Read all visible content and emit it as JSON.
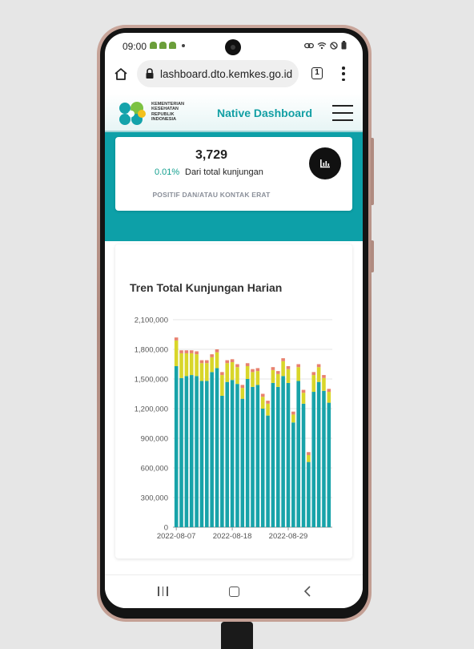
{
  "status_bar": {
    "time": "09:00",
    "right_icons": [
      "link-icon",
      "wifi-icon",
      "do-not-disturb-icon",
      "battery-icon"
    ]
  },
  "browser": {
    "url": "lashboard.dto.kemkes.go.id",
    "tab_count": "1"
  },
  "site": {
    "logo_text": [
      "KEMENTERIAN",
      "KESEHATAN",
      "REPUBLIK",
      "INDONESIA"
    ],
    "title": "Native Dashboard"
  },
  "stat_card": {
    "value": "3,729",
    "percent": "0.01%",
    "description": "Dari total kunjungan",
    "label": "POSITIF DAN/ATAU KONTAK ERAT"
  },
  "colors": {
    "teal": "#0da0a8",
    "series_main": "#18a3a9",
    "series_mid": "#d9d62a",
    "series_top": "#e8826e"
  },
  "chart_data": {
    "type": "bar",
    "stacked": true,
    "title": "Tren Total Kunjungan Harian",
    "x_tick_labels": [
      "2022-08-07",
      "2022-08-18",
      "2022-08-29"
    ],
    "y_ticks": [
      0,
      300000,
      600000,
      900000,
      1200000,
      1500000,
      1800000,
      2100000
    ],
    "y_tick_labels": [
      "0",
      "300,000",
      "600,000",
      "900,000",
      "1,200,000",
      "1,500,000",
      "1,800,000",
      "2,100,000"
    ],
    "ylim": [
      0,
      2100000
    ],
    "grid": true,
    "legend": "none",
    "categories": [
      "2022-08-07",
      "2022-08-08",
      "2022-08-09",
      "2022-08-10",
      "2022-08-11",
      "2022-08-12",
      "2022-08-13",
      "2022-08-14",
      "2022-08-15",
      "2022-08-16",
      "2022-08-17",
      "2022-08-18",
      "2022-08-19",
      "2022-08-20",
      "2022-08-21",
      "2022-08-22",
      "2022-08-23",
      "2022-08-24",
      "2022-08-25",
      "2022-08-26",
      "2022-08-27",
      "2022-08-28",
      "2022-08-29",
      "2022-08-30",
      "2022-08-31",
      "2022-09-01",
      "2022-09-02",
      "2022-09-03",
      "2022-09-04",
      "2022-09-05",
      "2022-09-06"
    ],
    "series": [
      {
        "values": [
          1630000,
          1510000,
          1530000,
          1540000,
          1530000,
          1480000,
          1480000,
          1570000,
          1610000,
          1330000,
          1470000,
          1490000,
          1450000,
          1300000,
          1500000,
          1420000,
          1440000,
          1200000,
          1130000,
          1460000,
          1420000,
          1530000,
          1460000,
          1060000,
          1480000,
          1250000,
          660000,
          1370000,
          1470000,
          1380000,
          1260000
        ]
      },
      {
        "values": [
          260000,
          250000,
          230000,
          220000,
          220000,
          180000,
          180000,
          150000,
          160000,
          210000,
          190000,
          180000,
          170000,
          110000,
          130000,
          150000,
          140000,
          120000,
          120000,
          130000,
          130000,
          150000,
          140000,
          80000,
          140000,
          110000,
          70000,
          170000,
          150000,
          130000,
          110000
        ]
      },
      {
        "values": [
          30000,
          30000,
          30000,
          30000,
          30000,
          30000,
          30000,
          30000,
          30000,
          30000,
          30000,
          30000,
          30000,
          30000,
          30000,
          30000,
          30000,
          30000,
          30000,
          30000,
          30000,
          30000,
          30000,
          30000,
          30000,
          30000,
          30000,
          30000,
          30000,
          30000,
          30000
        ]
      }
    ]
  }
}
